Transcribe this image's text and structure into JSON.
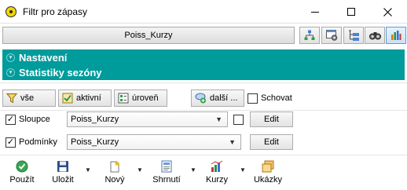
{
  "window": {
    "title": "Filtr pro zápasy"
  },
  "filter_name": "Poiss_Kurzy",
  "sections": {
    "settings": "Nastavení",
    "season_stats": "Statistiky sezóny"
  },
  "quick_buttons": {
    "all": "vše",
    "active": "aktivní",
    "level": "úroveň",
    "more": "další ...",
    "hide": "Schovat"
  },
  "rows": {
    "columns": {
      "label": "Sloupce",
      "value": "Poiss_Kurzy",
      "edit": "Edit",
      "checked": true
    },
    "conditions": {
      "label": "Podmínky",
      "value": "Poiss_Kurzy",
      "edit": "Edit",
      "checked": true
    }
  },
  "toolbar": {
    "use": "Použít",
    "save": "Uložit",
    "new": "Nový",
    "summary": "Shrnutí",
    "odds": "Kurzy",
    "samples": "Ukázky"
  },
  "colors": {
    "section_bg": "#009b9b",
    "accent_blue": "#5b9bd5"
  }
}
